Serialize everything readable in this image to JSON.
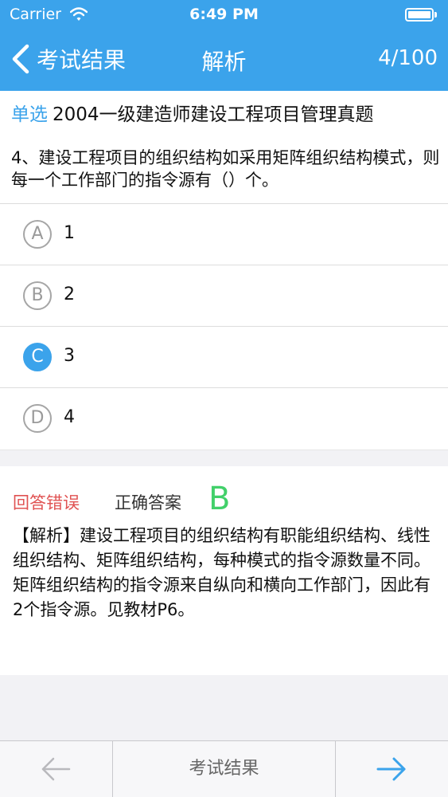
{
  "status_bar": {
    "carrier": "Carrier",
    "time": "6:49 PM"
  },
  "nav": {
    "back_label": "考试结果",
    "title": "解析",
    "counter": "4/100"
  },
  "question": {
    "type": "单选",
    "source": "2004一级建造师建设工程项目管理真题",
    "text": "4、建设工程项目的组织结构如采用矩阵组织结构模式，则每一个工作部门的指令源有（）个。"
  },
  "options": [
    {
      "letter": "A",
      "text": "1",
      "selected": false
    },
    {
      "letter": "B",
      "text": "2",
      "selected": false
    },
    {
      "letter": "C",
      "text": "3",
      "selected": true
    },
    {
      "letter": "D",
      "text": "4",
      "selected": false
    }
  ],
  "analysis": {
    "result": "回答错误",
    "correct_label": "正确答案",
    "correct_answer": "B",
    "explanation": "【解析】建设工程项目的组织结构有职能组织结构、线性组织结构、矩阵组织结构，每种模式的指令源数量不同。矩阵组织结构的指令源来自纵向和横向工作部门，因此有2个指令源。见教材P6。"
  },
  "bottom_bar": {
    "prev_icon": "arrow-left-icon",
    "center_label": "考试结果",
    "next_icon": "arrow-right-icon"
  },
  "colors": {
    "accent": "#3ba3eb",
    "wrong": "#e05252",
    "correct": "#42d06a"
  }
}
